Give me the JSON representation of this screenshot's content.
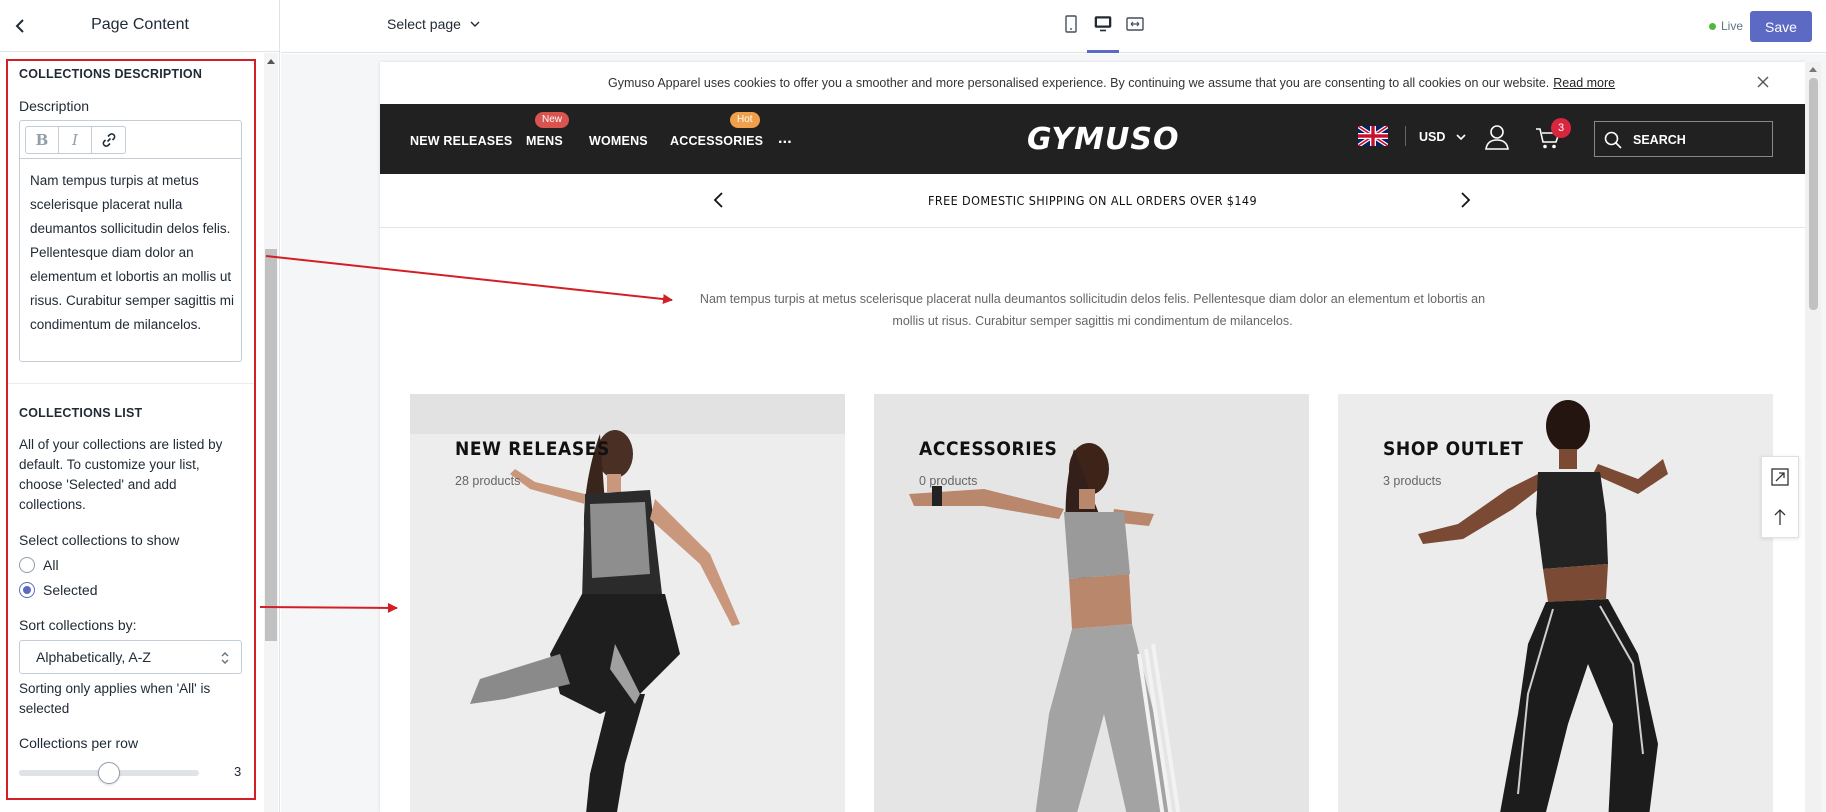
{
  "sidebar": {
    "title": "Page Content",
    "back_icon": "chevron-left-icon",
    "collections_description": {
      "heading": "COLLECTIONS DESCRIPTION",
      "description_label": "Description",
      "toolbar": {
        "bold": "B",
        "italic": "I",
        "link_icon": "link-icon"
      },
      "text": "Nam tempus turpis at metus scelerisque placerat nulla deumantos sollicitudin delos felis. Pellentesque diam dolor an elementum et lobortis an mollis ut risus. Curabitur semper sagittis mi condimentum de milancelos."
    },
    "collections_list": {
      "heading": "COLLECTIONS LIST",
      "help": "All of your collections are listed by default. To customize your list, choose 'Selected' and add collections.",
      "select_label": "Select collections to show",
      "options": [
        "All",
        "Selected"
      ],
      "selected_option": "Selected",
      "sort_label": "Sort collections by:",
      "sort_value": "Alphabetically, A-Z",
      "sort_help": "Sorting only applies when 'All' is selected",
      "per_row_label": "Collections per row",
      "per_row_value": "3",
      "per_row_fraction": 0.5
    }
  },
  "topbar": {
    "select_page": "Select page",
    "devices": [
      "mobile-icon",
      "desktop-icon",
      "fullwidth-icon"
    ],
    "active_device": "desktop-icon",
    "live_label": "Live",
    "save_label": "Save"
  },
  "preview": {
    "cookie_text": "Gymuso Apparel uses cookies to offer you a smoother and more personalised experience. By continuing we assume that you are consenting to all cookies on our website.",
    "cookie_link": "Read more",
    "nav": {
      "items": [
        "NEW RELEASES",
        "MENS",
        "WOMENS",
        "ACCESSORIES",
        "..."
      ],
      "badge_new": "New",
      "badge_hot": "Hot",
      "logo": "GYMUSO",
      "currency": "USD",
      "cart_count": "3",
      "search_placeholder": "SEARCH"
    },
    "announcement": "FREE DOMESTIC SHIPPING ON ALL ORDERS OVER $149",
    "collections_text": "Nam tempus turpis at metus scelerisque placerat nulla deumantos sollicitudin delos felis. Pellentesque diam dolor an elementum et lobortis an mollis ut risus. Curabitur semper sagittis mi condimentum de milancelos.",
    "cards": [
      {
        "title": "NEW RELEASES",
        "count": "28 products"
      },
      {
        "title": "ACCESSORIES",
        "count": "0 products"
      },
      {
        "title": "SHOP OUTLET",
        "count": "3 products"
      }
    ]
  },
  "colors": {
    "accent": "#5c6ac4",
    "highlight": "#d21f26",
    "nav_bg": "#212121",
    "badge_new": "#d9534f",
    "badge_hot": "#f0a04b"
  }
}
